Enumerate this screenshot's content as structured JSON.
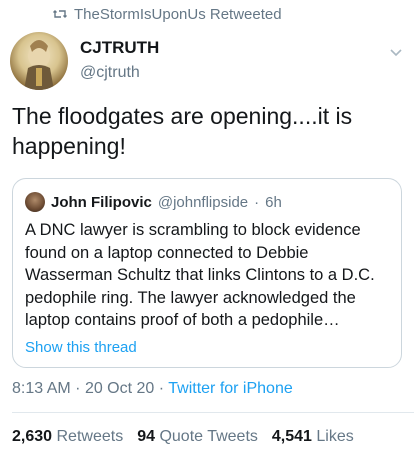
{
  "retweet_banner": {
    "text": "TheStormIsUponUs Retweeted",
    "icon": "retweet-icon"
  },
  "author": {
    "display_name": "CJTRUTH",
    "handle": "@cjtruth"
  },
  "tweet": {
    "text": "The floodgates are opening....it is happening!"
  },
  "quote": {
    "display_name": "John Filipovic",
    "handle": "@johnflipside",
    "separator": "·",
    "age": "6h",
    "text": "A DNC lawyer is scrambling to block evidence found on a laptop connected to Debbie Wasserman Schultz that links Clintons to a D.C. pedophile ring. The lawyer acknowledged the laptop contains proof of both a pedophile…",
    "show_thread": "Show this thread"
  },
  "meta": {
    "time": "8:13 AM",
    "date": "20 Oct 20",
    "separator": "·",
    "source": "Twitter for iPhone"
  },
  "stats": {
    "retweets_count": "2,630",
    "retweets_label": "Retweets",
    "quotes_count": "94",
    "quotes_label": "Quote Tweets",
    "likes_count": "4,541",
    "likes_label": "Likes"
  },
  "colors": {
    "accent": "#1da1f2",
    "muted": "#657786",
    "text": "#14171a",
    "border": "#ccd6dd"
  }
}
